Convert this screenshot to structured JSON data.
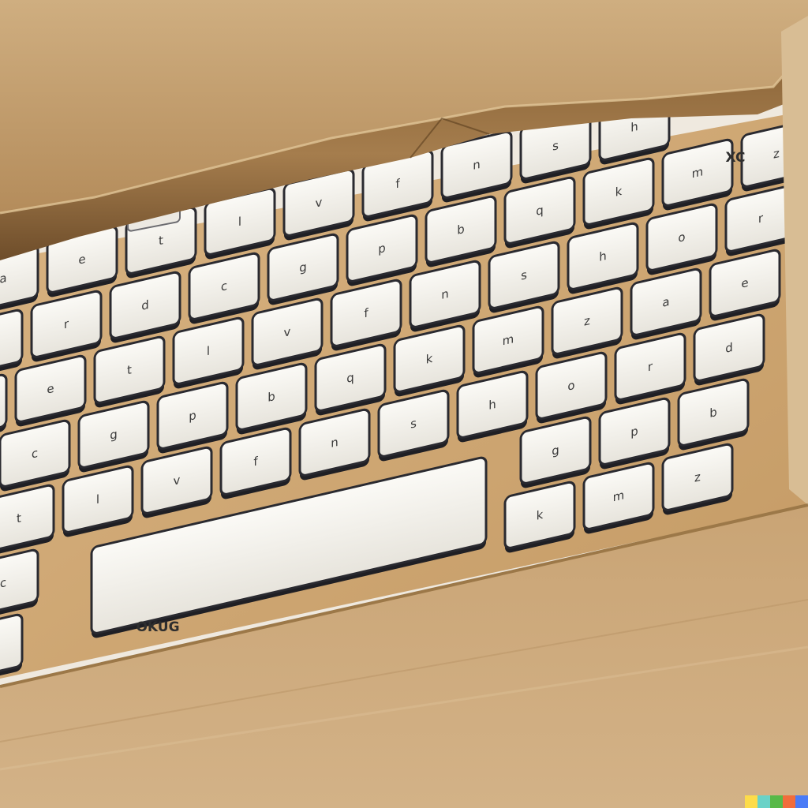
{
  "scene": {
    "subject": "keyboard-in-cardboard-box",
    "colors": {
      "cardboard_light": "#caa679",
      "cardboard_mid": "#b89465",
      "cardboard_dark": "#7a5a35",
      "keycap": "#f3f1ec",
      "keycap_border": "#1f1f24",
      "background": "#efe9df"
    }
  },
  "keys": {
    "top_right_label": "XC",
    "bottom_left_label": "OKUG",
    "glyphs": [
      "a",
      "e",
      "t",
      "l",
      "v",
      "f",
      "n",
      "s",
      "h",
      "o",
      "r",
      "d",
      "c",
      "g",
      "p",
      "b",
      "q",
      "k",
      "m",
      "z"
    ]
  },
  "watermark": {
    "colors": [
      "#fddc4a",
      "#6ad2c7",
      "#58b948",
      "#f16d3c",
      "#4a7bf6"
    ]
  }
}
